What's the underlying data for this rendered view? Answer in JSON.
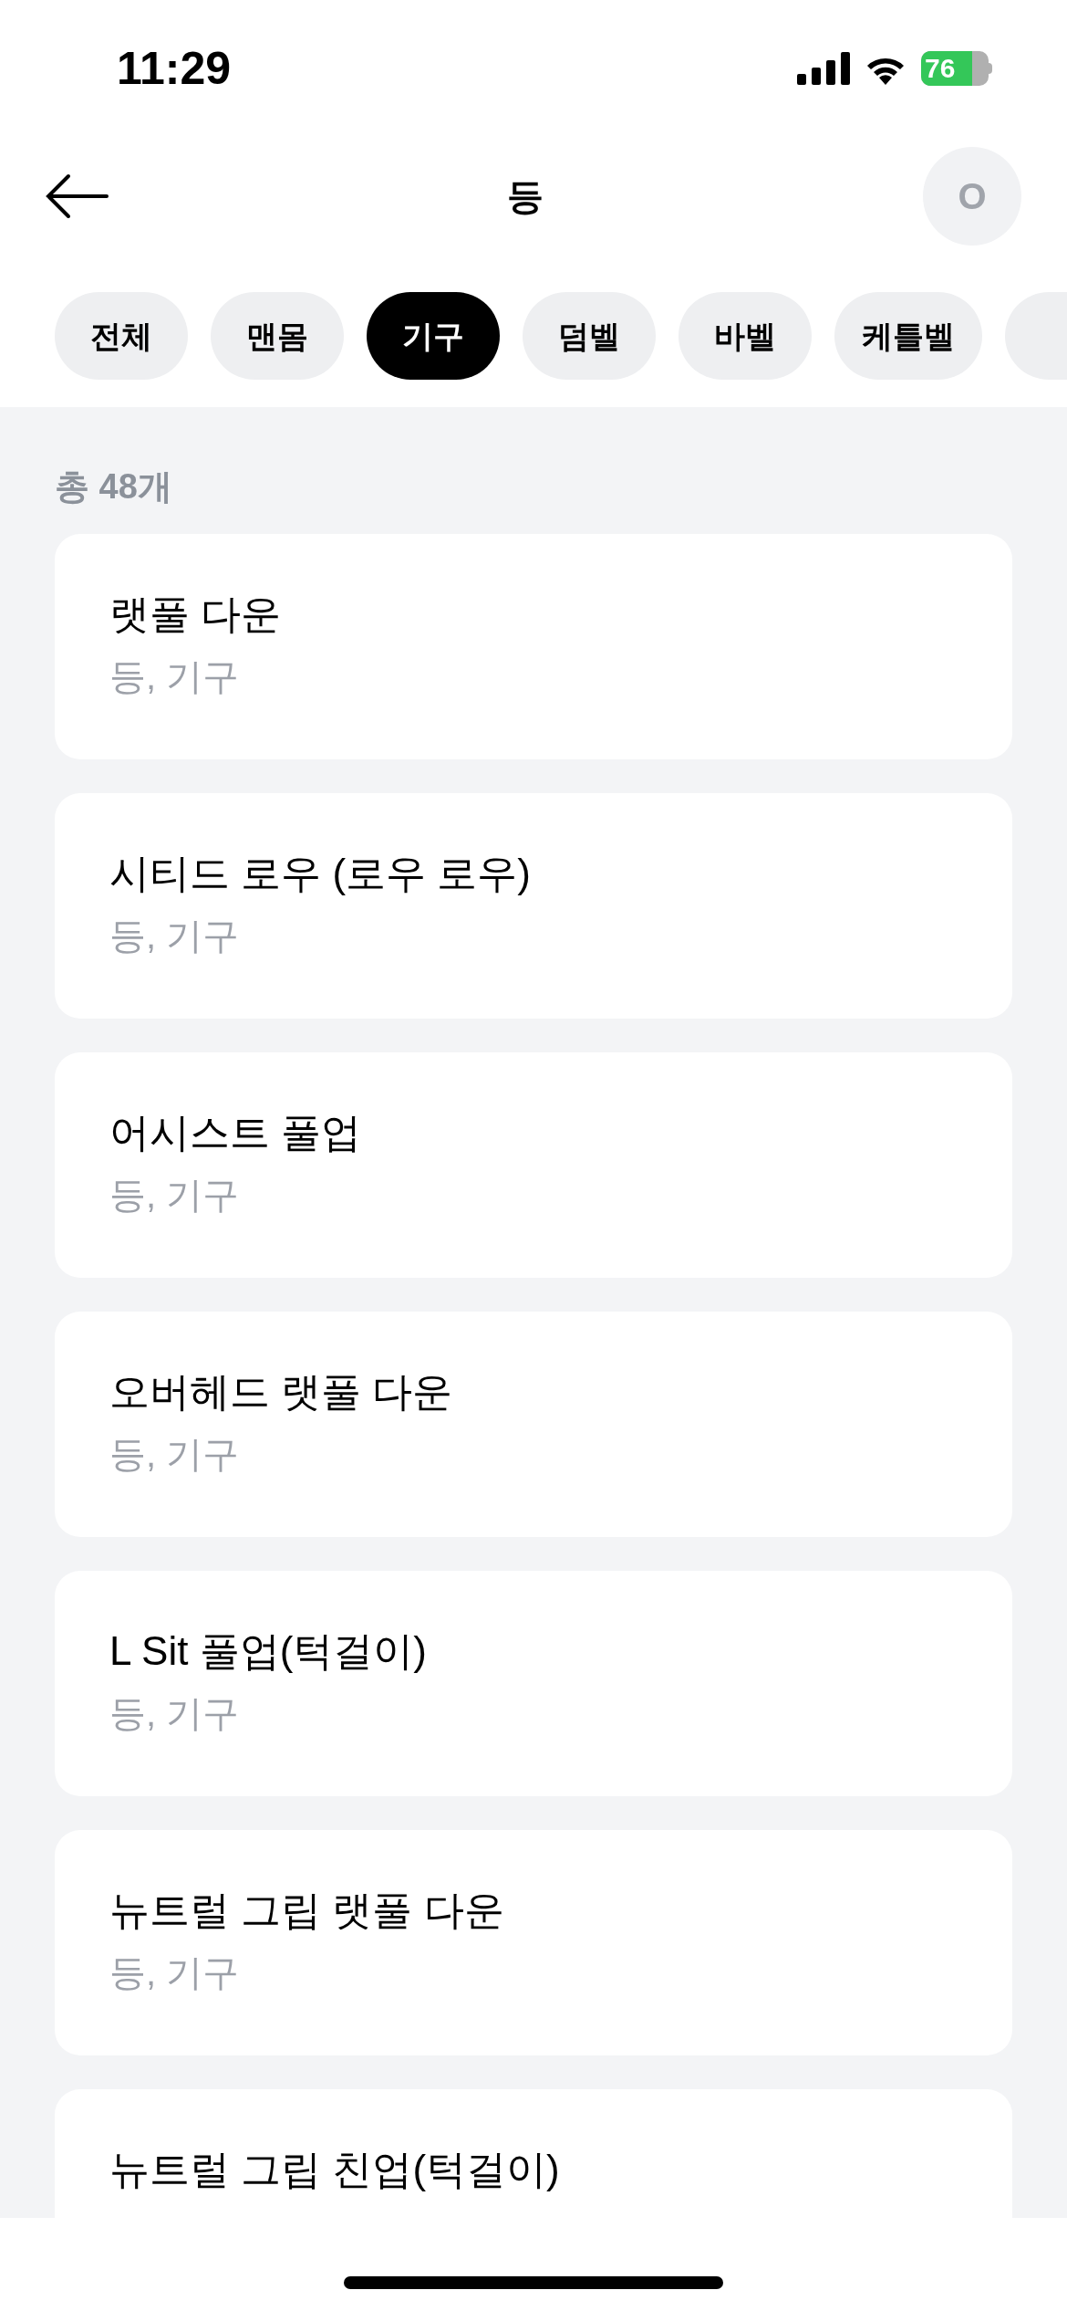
{
  "status_bar": {
    "time": "11:29",
    "battery": "76"
  },
  "header": {
    "title": "등",
    "avatar_initial": "O"
  },
  "filters": [
    {
      "label": "전체",
      "selected": false
    },
    {
      "label": "맨몸",
      "selected": false
    },
    {
      "label": "기구",
      "selected": true
    },
    {
      "label": "덤벨",
      "selected": false
    },
    {
      "label": "바벨",
      "selected": false
    },
    {
      "label": "케틀벨",
      "selected": false
    },
    {
      "selected": false
    }
  ],
  "total_count": "총 48개",
  "exercises": [
    {
      "name": "랫풀 다운",
      "tags": "등, 기구"
    },
    {
      "name": "시티드 로우 (로우 로우)",
      "tags": "등, 기구"
    },
    {
      "name": "어시스트 풀업",
      "tags": "등, 기구"
    },
    {
      "name": "오버헤드 랫풀 다운",
      "tags": "등, 기구"
    },
    {
      "name": "L Sit 풀업(턱걸이)",
      "tags": "등, 기구"
    },
    {
      "name": "뉴트럴 그립 랫풀 다운",
      "tags": "등, 기구"
    },
    {
      "name": "뉴트럴 그립 친업(턱걸이)"
    }
  ]
}
